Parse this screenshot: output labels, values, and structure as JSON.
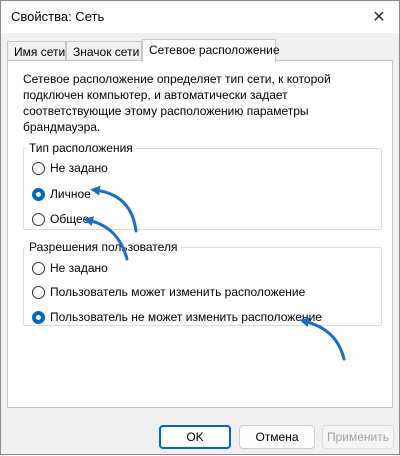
{
  "window": {
    "title": "Свойства: Сеть",
    "close_glyph": "✕"
  },
  "tabs": [
    {
      "label": "Имя сети"
    },
    {
      "label": "Значок сети"
    },
    {
      "label": "Сетевое расположение"
    }
  ],
  "active_tab": 2,
  "panel": {
    "description": "Сетевое расположение определяет тип сети, к которой подключен компьютер, и автоматически задает соответствующие этому расположению параметры брандмауэра."
  },
  "location_type": {
    "legend": "Тип расположения",
    "options": [
      {
        "label": "Не задано",
        "checked": false
      },
      {
        "label": "Личное",
        "checked": true
      },
      {
        "label": "Общее",
        "checked": false
      }
    ]
  },
  "user_permissions": {
    "legend": "Разрешения пользователя",
    "options": [
      {
        "label": "Не задано",
        "checked": false
      },
      {
        "label": "Пользователь может изменить расположение",
        "checked": false
      },
      {
        "label": "Пользователь не может изменить расположение",
        "checked": true
      }
    ]
  },
  "buttons": {
    "ok": "OK",
    "cancel": "Отмена",
    "apply": "Применить"
  },
  "colors": {
    "accent": "#0067c0",
    "annotation_arrow": "#1a6fc4"
  }
}
